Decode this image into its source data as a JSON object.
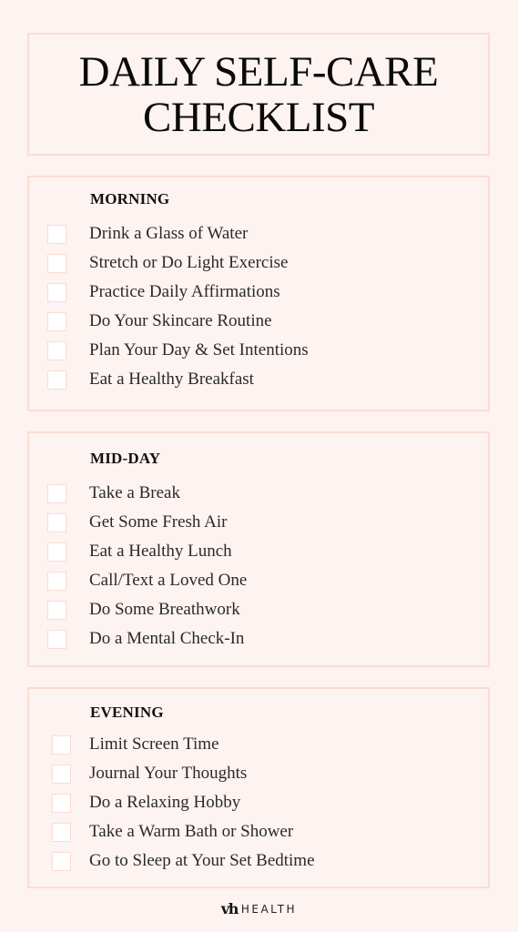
{
  "title": {
    "line1": "DAILY SELF-CARE",
    "line2": "CHECKLIST"
  },
  "sections": [
    {
      "heading": "MORNING",
      "items": [
        {
          "label": "Drink a Glass of Water",
          "checked": false
        },
        {
          "label": "Stretch or Do Light Exercise",
          "checked": false
        },
        {
          "label": "Practice Daily Affirmations",
          "checked": false
        },
        {
          "label": "Do Your Skincare Routine",
          "checked": false
        },
        {
          "label": "Plan Your Day & Set Intentions",
          "checked": false
        },
        {
          "label": "Eat a Healthy Breakfast",
          "checked": false
        }
      ]
    },
    {
      "heading": "MID-DAY",
      "items": [
        {
          "label": "Take a Break",
          "checked": false
        },
        {
          "label": "Get Some Fresh Air",
          "checked": false
        },
        {
          "label": "Eat a Healthy Lunch",
          "checked": false
        },
        {
          "label": "Call/Text a Loved One",
          "checked": false
        },
        {
          "label": "Do Some Breathwork",
          "checked": false
        },
        {
          "label": "Do a Mental Check-In",
          "checked": false
        }
      ]
    },
    {
      "heading": "EVENING",
      "items": [
        {
          "label": "Limit Screen Time",
          "checked": false
        },
        {
          "label": "Journal Your Thoughts",
          "checked": false
        },
        {
          "label": "Do a Relaxing Hobby",
          "checked": false
        },
        {
          "label": "Take a Warm Bath or Shower",
          "checked": false
        },
        {
          "label": "Go to Sleep at Your Set Bedtime",
          "checked": false
        }
      ]
    }
  ],
  "footer": {
    "logo_mark": "vh",
    "logo_text": "HEALTH"
  },
  "colors": {
    "background": "#fdf3f1",
    "border": "#fbdcd4",
    "text": "#222222"
  }
}
